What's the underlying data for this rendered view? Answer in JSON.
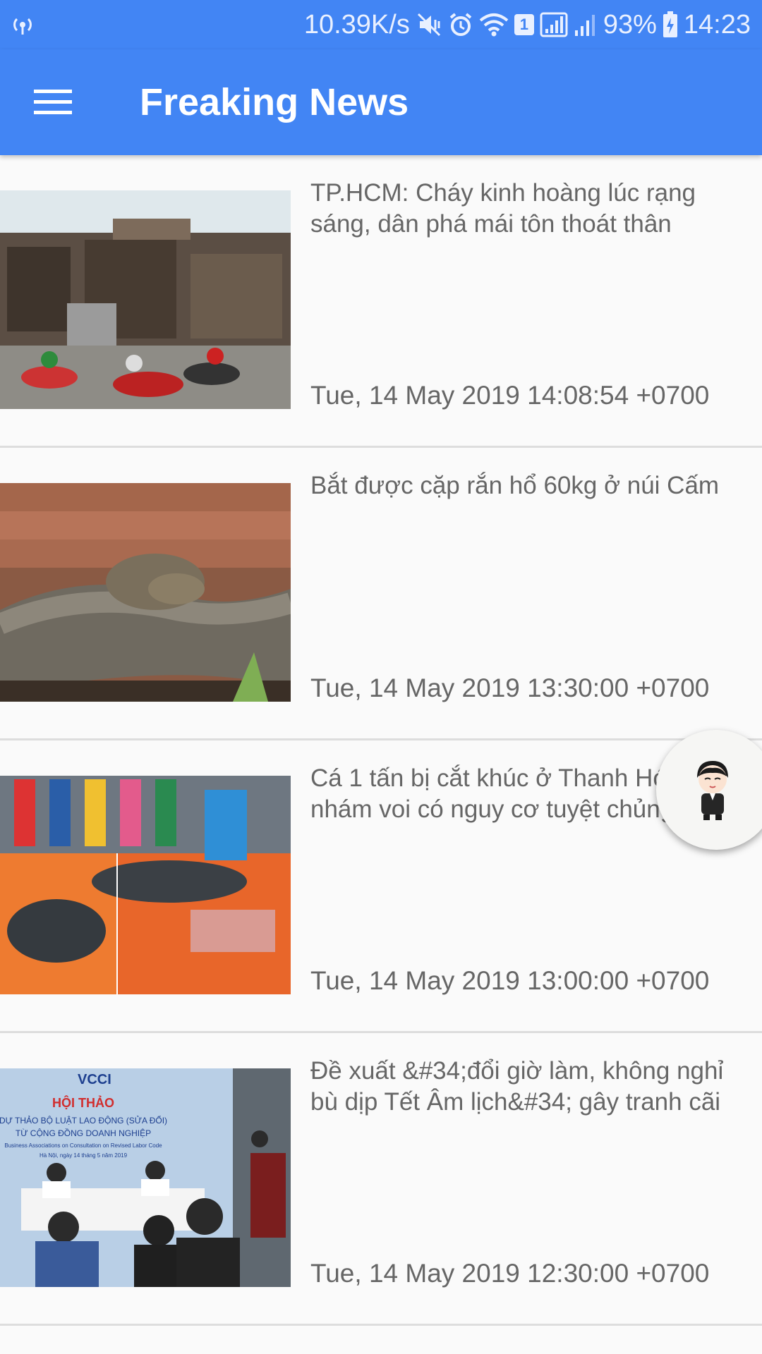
{
  "status_bar": {
    "net_speed": "10.39K/s",
    "sim_badge": "1",
    "battery": "93%",
    "time": "14:23",
    "icons": [
      "broadcast-icon",
      "mute-vibrate-icon",
      "alarm-icon",
      "wifi-icon",
      "signal-icon",
      "signal-icon-2",
      "battery-charging-icon"
    ]
  },
  "app_bar": {
    "title": "Freaking News",
    "menu_icon": "hamburger-menu-icon",
    "color": "#4285f4"
  },
  "news": [
    {
      "title": "TP.HCM: Cháy kinh hoàng lúc rạng sáng, dân phá mái tôn thoát thân",
      "date": "Tue, 14 May 2019 14:08:54 +0700",
      "image": "fire-damaged-street-photo"
    },
    {
      "title": "Bắt được cặp rắn hổ 60kg ở núi Cấm",
      "date": "Tue, 14 May 2019 13:30:00 +0700",
      "image": "king-cobra-photo"
    },
    {
      "title": "Cá 1 tấn bị cắt khúc ở Thanh Hóa là cá nhám voi có nguy cơ tuyệt chủng",
      "date": "Tue, 14 May 2019 13:00:00 +0700",
      "image": "whale-shark-photo"
    },
    {
      "title": "Đề xuất &#34;đổi giờ làm, không nghỉ bù dịp Tết Âm lịch&#34; gây tranh cãi",
      "date": "Tue, 14 May 2019 12:30:00 +0700",
      "image": "conference-photo",
      "image_text": {
        "brand": "VCCI",
        "heading": "HỘI THẢO",
        "line1": "DỰ THẢO BỘ LUẬT LAO ĐỘNG (SỬA ĐỔI)",
        "line2": "TỪ CỘNG ĐỒNG DOANH NGHIỆP",
        "line3": "Business Associations on Consultation on Revised Labor Code",
        "line4": "Hà Nội, ngày 14 tháng 5 năm 2019"
      }
    }
  ],
  "fab": {
    "icon": "avatar-assistant-icon"
  }
}
